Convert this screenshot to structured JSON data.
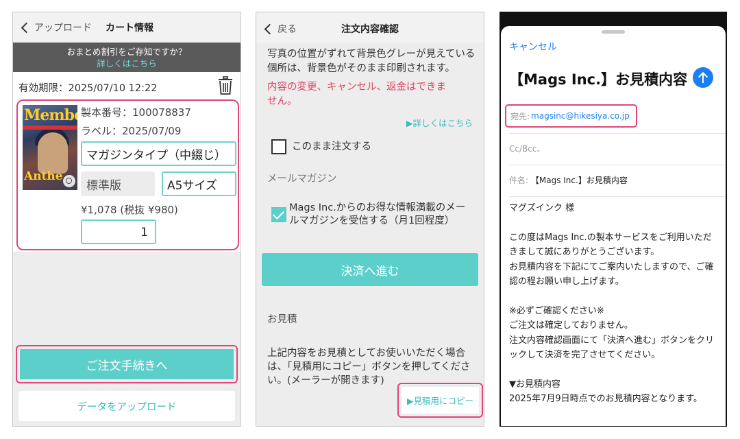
{
  "cart_screen": {
    "nav": {
      "back_label": "アップロード",
      "title": "カート情報"
    },
    "promo": {
      "line1": "おまとめ割引をご存知ですか？",
      "link": "詳しくはこちら"
    },
    "expiry": "有効期限：2025/07/10 12:22",
    "item": {
      "cover_title": "Member",
      "cover_bottom": "Anthe",
      "product_number": "製本番号：100078837",
      "label": "ラベル：2025/07/09",
      "type": "マガジンタイプ（中綴じ）",
      "edition": "標準版",
      "size": "A5サイズ",
      "price": "¥1,078 (税抜 ¥980)",
      "quantity": "1"
    },
    "order_button": "ご注文手続きへ",
    "upload_button": "データをアップロード",
    "highlight_color": "#e0457b",
    "accent_color": "#5ccfca"
  },
  "confirm_screen": {
    "nav": {
      "back_label": "戻る",
      "title": "注文内容確認"
    },
    "notice": "写真の位置がずれて背景色グレーが見えている個所は、背景色がそのまま印刷されます。",
    "warning": "内容の変更、キャンセル、返金はできません。",
    "details_link": "▶詳しくはこちら",
    "order_as_is": {
      "label": "このまま注文する",
      "checked": false
    },
    "newsletter_heading": "メールマガジン",
    "newsletter_opt": {
      "label": "Mags Inc.からのお得な情報満載のメールマガジンを受信する（月1回程度）",
      "checked": true
    },
    "pay_button": "決済へ進む",
    "quote_heading": "お見積",
    "quote_text": "上記内容をお見積としてお使いいただく場合は、「見積用にコピー」ボタンを押してください。(メーラーが開きます)",
    "copy_button": "▶見積用にコピー"
  },
  "mail_screen": {
    "cancel": "キャンセル",
    "subject_title": "【Mags Inc.】お見積内容",
    "to_label": "宛先:",
    "to_address": "magsinc@hikesiya.co.jp",
    "cc_label": "Cc/Bcc、",
    "subject_label": "件名:",
    "subject_value": "【Mags Inc.】お見積内容",
    "body": [
      "マグズインク 様",
      "この度はMags Inc.の製本サービスをご利用いただきまして誠にありがとうございます。\nお見積内容を下記にてご案内いたしますので、ご確認の程お願い申し上げます。",
      "※必ずご確認ください※\nご注文は確定しておりません。\n注文内容確認画面にて「決済へ進む」ボタンをクリックして決済を完了させてください。",
      "▼お見積内容\n2025年7月9日時点でのお見積内容となります。"
    ],
    "link_color": "#1a7ff0"
  }
}
